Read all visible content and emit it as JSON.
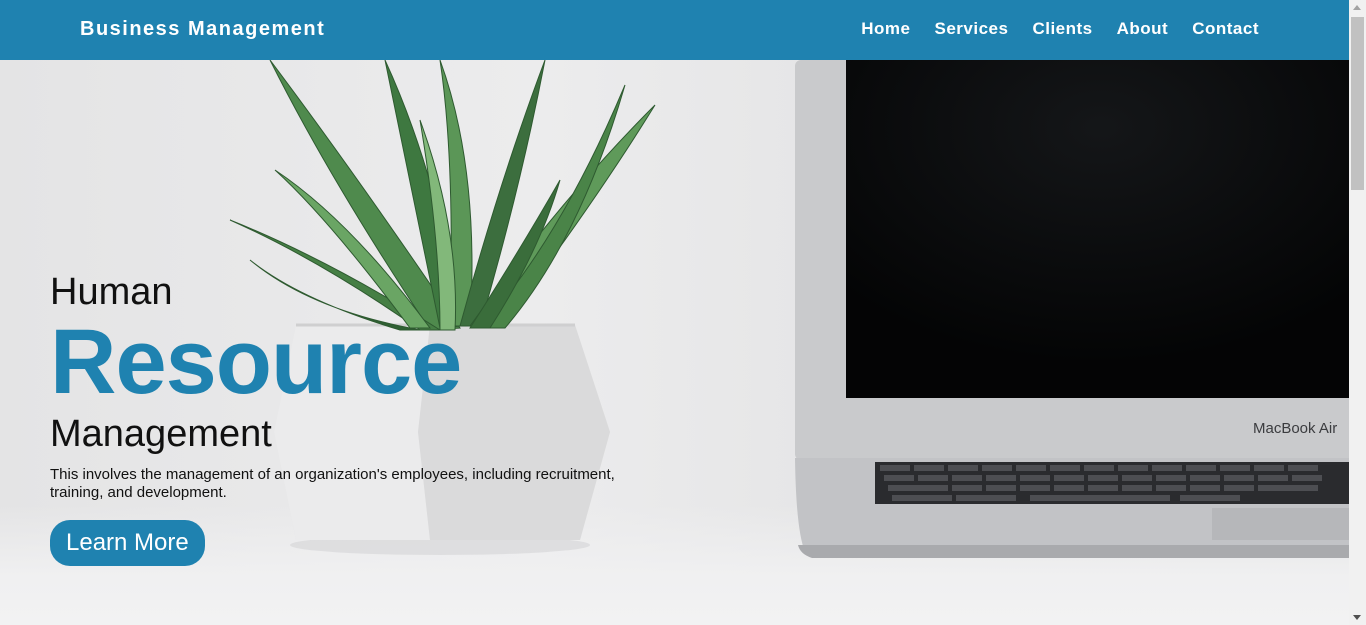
{
  "nav": {
    "brand": "Business Management",
    "links": [
      "Home",
      "Services",
      "Clients",
      "About",
      "Contact"
    ]
  },
  "hero": {
    "line1": "Human",
    "line2": "Resource",
    "line3": "Management",
    "description": "This involves the management of an organization's employees, including recruitment, training, and development.",
    "cta_label": "Learn More",
    "laptop_label": "MacBook Air"
  },
  "colors": {
    "accent": "#1f82b0",
    "text": "#111111"
  }
}
